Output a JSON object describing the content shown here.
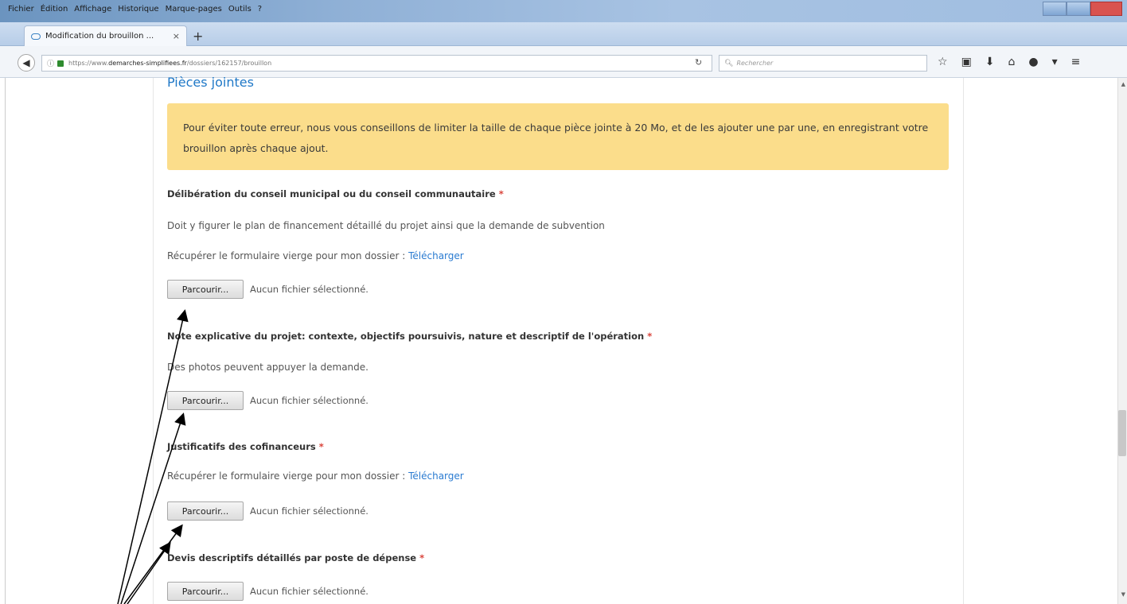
{
  "window": {
    "menu": [
      "Fichier",
      "Édition",
      "Affichage",
      "Historique",
      "Marque-pages",
      "Outils",
      "?"
    ]
  },
  "browser": {
    "tab_title": "Modification du brouillon ...",
    "tab_close": "×",
    "new_tab": "+",
    "url_prefix": "https://www.",
    "url_domain": "demarches-simplifiees.fr",
    "url_path": "/dossiers/162157/brouillon",
    "search_placeholder": "Rechercher"
  },
  "page": {
    "section_title": "Pièces jointes",
    "notice": "Pour éviter toute erreur, nous vous conseillons de limiter la taille de chaque pièce jointe à 20 Mo, et de les ajouter une par une, en enregistrant votre brouillon après chaque ajout.",
    "browse_label": "Parcourir...",
    "no_file_text": "Aucun fichier sélectionné.",
    "required_mark": "*",
    "download_prefix": "Récupérer le formulaire vierge pour mon dossier : ",
    "download_link": "Télécharger",
    "fields": [
      {
        "label": "Délibération du conseil municipal ou du conseil communautaire",
        "description": "Doit y figurer le plan de financement détaillé du projet ainsi que la demande de subvention"
      },
      {
        "label": "Note explicative du projet: contexte, objectifs poursuivis, nature et descriptif de l'opération",
        "description": "Des photos peuvent appuyer la demande."
      },
      {
        "label": "Justificatifs des cofinanceurs"
      },
      {
        "label": "Devis descriptifs détaillés par poste de dépense"
      }
    ]
  }
}
